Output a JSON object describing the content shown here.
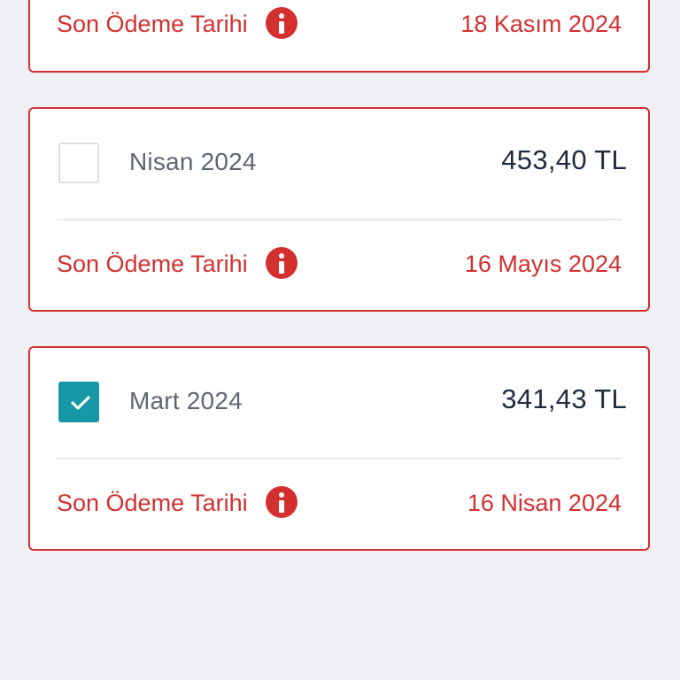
{
  "colors": {
    "accent_red": "#d32f2f",
    "checked_teal": "#1597a6",
    "background": "#eef0f3"
  },
  "cards": [
    {
      "due_label": "Son Ödeme Tarihi",
      "due_date": "18 Kasım 2024",
      "icon": "info-icon"
    },
    {
      "period": "Nisan 2024",
      "amount": "453,40 TL",
      "checked": false,
      "due_label": "Son Ödeme Tarihi",
      "due_date": "16 Mayıs 2024",
      "icon": "info-icon"
    },
    {
      "period": "Mart 2024",
      "amount": "341,43 TL",
      "checked": true,
      "due_label": "Son Ödeme Tarihi",
      "due_date": "16 Nisan 2024",
      "icon": "info-icon"
    }
  ]
}
